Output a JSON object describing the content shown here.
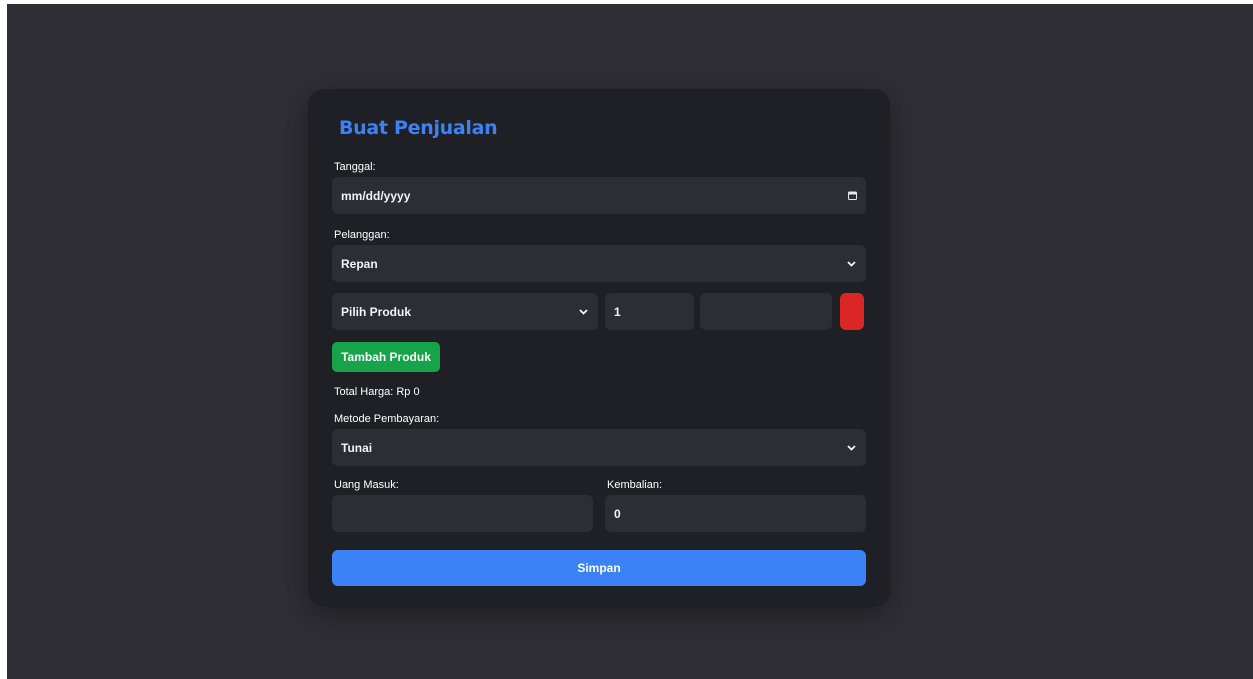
{
  "form": {
    "title": "Buat Penjualan",
    "tanggal_label": "Tanggal:",
    "tanggal_placeholder": "mm/dd/yyyy",
    "pelanggan_label": "Pelanggan:",
    "pelanggan_value": "Repan",
    "product_row": {
      "product_value": "Pilih Produk",
      "quantity_value": "1",
      "price_value": ""
    },
    "add_product_label": "Tambah Produk",
    "total_label": "Total Harga: Rp 0",
    "metode_label": "Metode Pembayaran:",
    "metode_value": "Tunai",
    "uang_masuk_label": "Uang Masuk:",
    "uang_masuk_value": "",
    "kembalian_label": "Kembalian:",
    "kembalian_value": "0",
    "save_label": "Simpan"
  },
  "icons": {
    "date": "calendar-icon",
    "dropdown": "chevron-down-icon"
  },
  "colors": {
    "accent": "#3b82f6",
    "add_button": "#16a34a",
    "remove_button": "#dc2626",
    "card_bg": "#1f2025",
    "page_bg": "#2f2e34",
    "field_bg": "#2d2e35"
  }
}
